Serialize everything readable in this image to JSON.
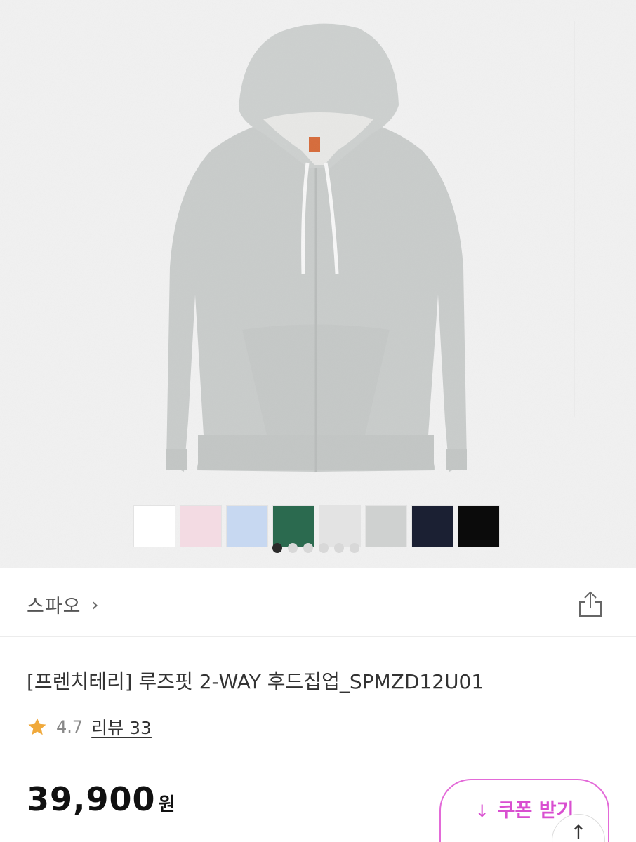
{
  "product_image": {
    "colors": [
      "#ffffff",
      "#f3dbe3",
      "#c7d8f1",
      "#2b6a4f",
      "#e3e3e3",
      "#cfd1d0",
      "#1b2033",
      "#0b0b0b"
    ],
    "active_dot_index": 0,
    "dot_count": 6
  },
  "brand": {
    "name": "스파오",
    "chevron": "›",
    "share_icon": "share-icon"
  },
  "product": {
    "title": "[프렌치테리] 루즈핏 2-WAY 후드집업_SPMZD12U01",
    "rating": "4.7",
    "review_label": "리뷰 33",
    "price": "39,900",
    "price_unit": "원"
  },
  "coupon": {
    "icon": "↓",
    "label": "쿠폰 받기"
  },
  "scroll_top": {
    "icon": "↑"
  },
  "theme": {
    "accent": "#d94fd0",
    "star": "#f0a93b"
  }
}
